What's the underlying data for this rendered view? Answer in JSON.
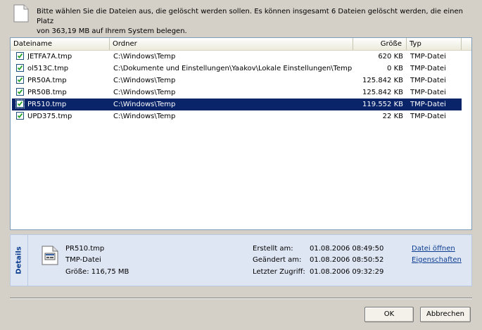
{
  "header": {
    "line1": "Bitte wählen Sie die Dateien aus, die gelöscht werden sollen. Es können insgesamt 6 Dateien gelöscht werden, die einen Platz",
    "line2": "von 363,19 MB auf Ihrem System belegen."
  },
  "list": {
    "columns": [
      "Dateiname",
      "Ordner",
      "Größe",
      "Typ"
    ],
    "rows": [
      {
        "name": "JETFA7A.tmp",
        "folder": "C:\\Windows\\Temp",
        "size": "620 KB",
        "type": "TMP-Datei",
        "checked": true,
        "selected": false
      },
      {
        "name": "ol513C.tmp",
        "folder": "C:\\Dokumente und Einstellungen\\Yaakov\\Lokale Einstellungen\\Temp",
        "size": "0 KB",
        "type": "TMP-Datei",
        "checked": true,
        "selected": false
      },
      {
        "name": "PR50A.tmp",
        "folder": "C:\\Windows\\Temp",
        "size": "125.842 KB",
        "type": "TMP-Datei",
        "checked": true,
        "selected": false
      },
      {
        "name": "PR50B.tmp",
        "folder": "C:\\Windows\\Temp",
        "size": "125.842 KB",
        "type": "TMP-Datei",
        "checked": true,
        "selected": false
      },
      {
        "name": "PR510.tmp",
        "folder": "C:\\Windows\\Temp",
        "size": "119.552 KB",
        "type": "TMP-Datei",
        "checked": true,
        "selected": true
      },
      {
        "name": "UPD375.tmp",
        "folder": "C:\\Windows\\Temp",
        "size": "22 KB",
        "type": "TMP-Datei",
        "checked": true,
        "selected": false
      }
    ]
  },
  "details": {
    "tab_label": "Details",
    "file_name": "PR510.tmp",
    "file_type": "TMP-Datei",
    "file_size": "Größe: 116,75 MB",
    "created_label": "Erstellt am:",
    "created_value": "01.08.2006 08:49:50",
    "modified_label": "Geändert am:",
    "modified_value": "01.08.2006 08:50:52",
    "accessed_label": "Letzter Zugriff:",
    "accessed_value": "01.08.2006 09:32:29",
    "open_link": "Datei öffnen",
    "properties_link": "Eigenschaften"
  },
  "buttons": {
    "ok": "OK",
    "cancel": "Abbrechen"
  },
  "colors": {
    "selection": "#0a246a",
    "link": "#0b3d91",
    "details_background": "#dfe6f3"
  },
  "icons": {
    "header": "document-icon",
    "details_file": "file-icon",
    "checkbox": "checkmark-icon"
  }
}
